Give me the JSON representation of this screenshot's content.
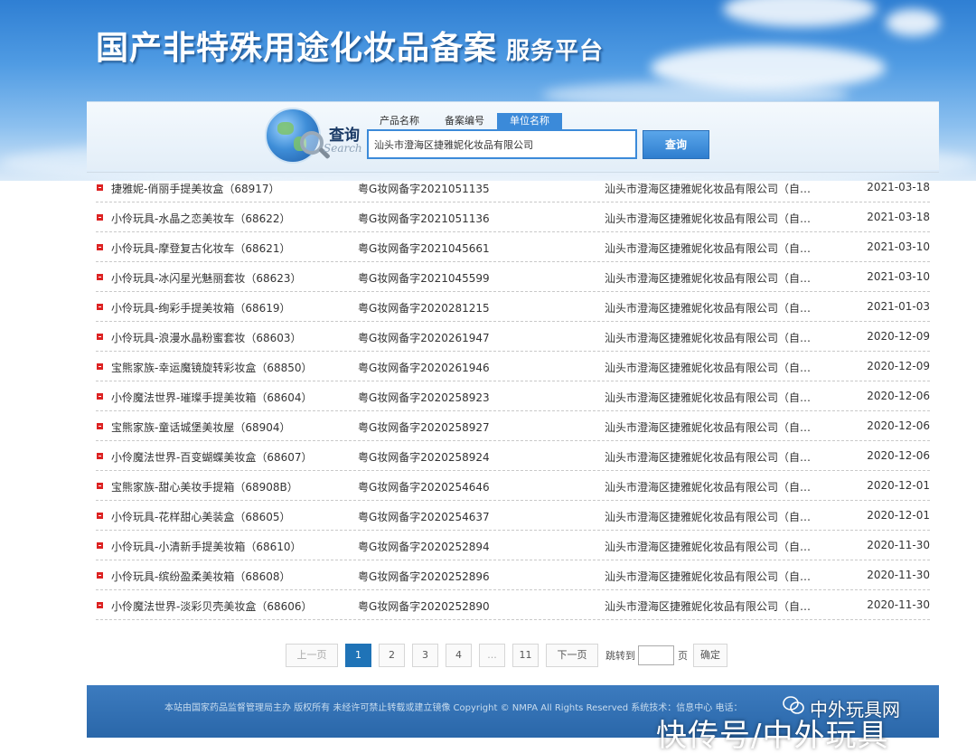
{
  "header": {
    "title": "国产非特殊用途化妆品备案",
    "subtitle": "服务平台"
  },
  "search": {
    "label": "查询",
    "label_en": "Search",
    "tabs": [
      "产品名称",
      "备案编号",
      "单位名称"
    ],
    "active_tab": "单位名称",
    "value": "汕头市澄海区捷雅妮化妆品有限公司",
    "button": "查询"
  },
  "rows": [
    {
      "name": "捷雅妮-俏丽手提美妆盒（68917）",
      "code": "粤G妆网备字2021051135",
      "company": "汕头市澄海区捷雅妮化妆品有限公司（自…",
      "date": "2021-03-18"
    },
    {
      "name": "小伶玩具-水晶之恋美妆车（68622）",
      "code": "粤G妆网备字2021051136",
      "company": "汕头市澄海区捷雅妮化妆品有限公司（自…",
      "date": "2021-03-18"
    },
    {
      "name": "小伶玩具-摩登复古化妆车（68621）",
      "code": "粤G妆网备字2021045661",
      "company": "汕头市澄海区捷雅妮化妆品有限公司（自…",
      "date": "2021-03-10"
    },
    {
      "name": "小伶玩具-冰闪星光魅丽套妆（68623）",
      "code": "粤G妆网备字2021045599",
      "company": "汕头市澄海区捷雅妮化妆品有限公司（自…",
      "date": "2021-03-10"
    },
    {
      "name": "小伶玩具-绚彩手提美妆箱（68619）",
      "code": "粤G妆网备字2020281215",
      "company": "汕头市澄海区捷雅妮化妆品有限公司（自…",
      "date": "2021-01-03"
    },
    {
      "name": "小伶玩具-浪漫水晶粉蜜套妆（68603）",
      "code": "粤G妆网备字2020261947",
      "company": "汕头市澄海区捷雅妮化妆品有限公司（自…",
      "date": "2020-12-09"
    },
    {
      "name": "宝熊家族-幸运魔镜旋转彩妆盒（68850）",
      "code": "粤G妆网备字2020261946",
      "company": "汕头市澄海区捷雅妮化妆品有限公司（自…",
      "date": "2020-12-09"
    },
    {
      "name": "小伶魔法世界-璀璨手提美妆箱（68604）",
      "code": "粤G妆网备字2020258923",
      "company": "汕头市澄海区捷雅妮化妆品有限公司（自…",
      "date": "2020-12-06"
    },
    {
      "name": "宝熊家族-童话城堡美妆屋（68904）",
      "code": "粤G妆网备字2020258927",
      "company": "汕头市澄海区捷雅妮化妆品有限公司（自…",
      "date": "2020-12-06"
    },
    {
      "name": "小伶魔法世界-百变蝴蝶美妆盒（68607）",
      "code": "粤G妆网备字2020258924",
      "company": "汕头市澄海区捷雅妮化妆品有限公司（自…",
      "date": "2020-12-06"
    },
    {
      "name": "宝熊家族-甜心美妆手提箱（68908B）",
      "code": "粤G妆网备字2020254646",
      "company": "汕头市澄海区捷雅妮化妆品有限公司（自…",
      "date": "2020-12-01"
    },
    {
      "name": "小伶玩具-花样甜心美装盒（68605）",
      "code": "粤G妆网备字2020254637",
      "company": "汕头市澄海区捷雅妮化妆品有限公司（自…",
      "date": "2020-12-01"
    },
    {
      "name": "小伶玩具-小清新手提美妆箱（68610）",
      "code": "粤G妆网备字2020252894",
      "company": "汕头市澄海区捷雅妮化妆品有限公司（自…",
      "date": "2020-11-30"
    },
    {
      "name": "小伶玩具-缤纷盈柔美妆箱（68608）",
      "code": "粤G妆网备字2020252896",
      "company": "汕头市澄海区捷雅妮化妆品有限公司（自…",
      "date": "2020-11-30"
    },
    {
      "name": "小伶魔法世界-淡彩贝壳美妆盒（68606）",
      "code": "粤G妆网备字2020252890",
      "company": "汕头市澄海区捷雅妮化妆品有限公司（自…",
      "date": "2020-11-30"
    }
  ],
  "pagination": {
    "prev": "上一页",
    "pages": [
      "1",
      "2",
      "3",
      "4",
      "...",
      "11"
    ],
    "current": "1",
    "next": "下一页",
    "jump_label": "跳转到",
    "jump_value": "",
    "jump_unit": "页",
    "confirm": "确定"
  },
  "footer": {
    "text": "本站由国家药品监督管理局主办 版权所有 未经许可禁止转载或建立镜像 Copyright © NMPA All Rights Reserved 系统技术：信息中心 电话："
  },
  "watermark": {
    "small": "中外玩具网",
    "big": "快传号/中外玩具"
  }
}
